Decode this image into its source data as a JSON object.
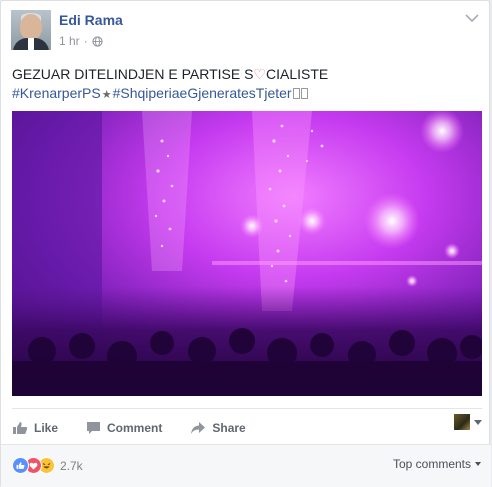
{
  "post": {
    "author": "Edi Rama",
    "time": "1 hr",
    "separator": "·",
    "text_line1_before": "GEZUAR DITELINDJEN E PARTISE S",
    "text_heart": "♡",
    "text_line1_after": "CIALISTE",
    "hashtag1": "#KrenarperPS",
    "star": "★",
    "hashtag2": "#ShqiperiaeGjeneratesTjeter"
  },
  "actions": {
    "like": "Like",
    "comment": "Comment",
    "share": "Share"
  },
  "footer": {
    "reaction_count": "2.7k",
    "top_comments": "Top comments"
  },
  "icons": {
    "globe": "globe-icon",
    "chevron": "chevron-down-icon",
    "like": "thumbs-up-icon",
    "comment": "comment-icon",
    "share": "share-arrow-icon"
  },
  "colors": {
    "link": "#365899",
    "accent_purple": "#9b2fe0",
    "like_blue": "#5890ff",
    "love_red": "#f25268",
    "haha_yellow": "#fcc33a"
  }
}
